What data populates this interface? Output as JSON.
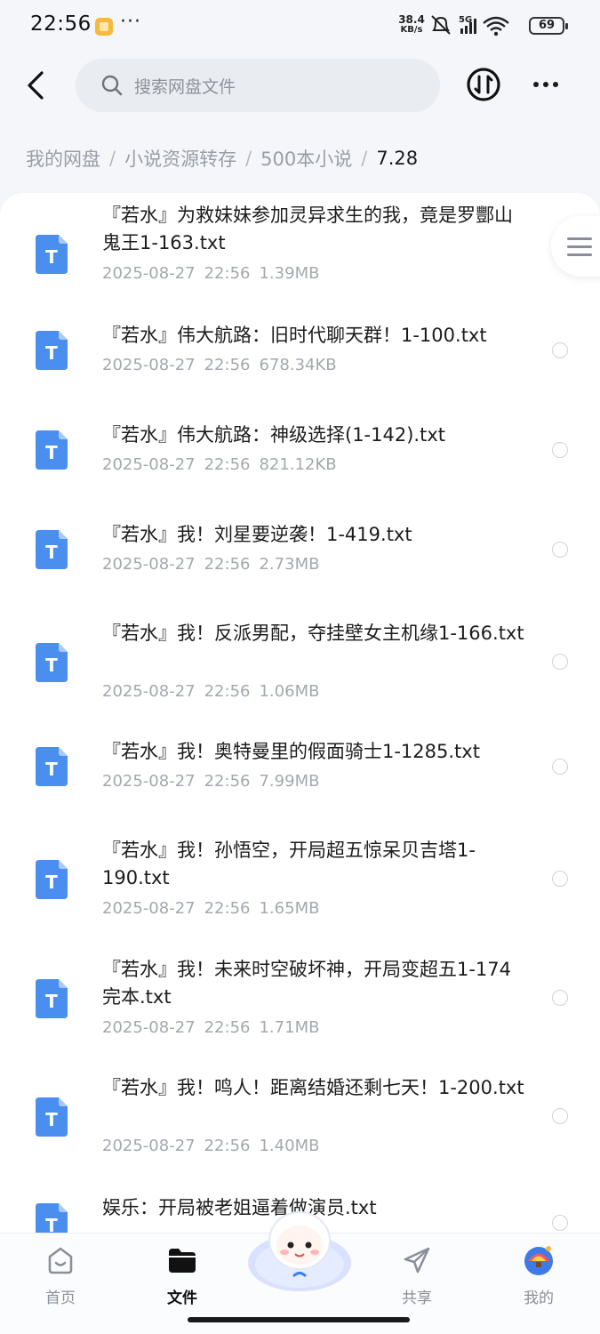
{
  "status_bar": {
    "time": "22:56",
    "more": "···",
    "speed_value": "38.4",
    "speed_unit": "KB/s",
    "network": "5G",
    "battery": "69"
  },
  "header": {
    "search_placeholder": "搜索网盘文件"
  },
  "breadcrumb": {
    "items": [
      "我的网盘",
      "小说资源转存",
      "500本小说"
    ],
    "current": "7.28",
    "separator": "/"
  },
  "files": [
    {
      "name": "『若水』为救妹妹参加灵异求生的我，竟是罗酆山鬼王1-163.txt",
      "date": "2025-08-27",
      "time": "22:56",
      "size": "1.39MB"
    },
    {
      "name": "『若水』伟大航路：旧时代聊天群！1-100.txt",
      "date": "2025-08-27",
      "time": "22:56",
      "size": "678.34KB"
    },
    {
      "name": "『若水』伟大航路：神级选择(1-142).txt",
      "date": "2025-08-27",
      "time": "22:56",
      "size": "821.12KB"
    },
    {
      "name": "『若水』我！刘星要逆袭！1-419.txt",
      "date": "2025-08-27",
      "time": "22:56",
      "size": "2.73MB"
    },
    {
      "name": "『若水』我！反派男配，夺挂壁女主机缘1-166.txt",
      "date": "2025-08-27",
      "time": "22:56",
      "size": "1.06MB"
    },
    {
      "name": "『若水』我！奥特曼里的假面骑士1-1285.txt",
      "date": "2025-08-27",
      "time": "22:56",
      "size": "7.99MB"
    },
    {
      "name": "『若水』我！孙悟空，开局超五惊呆贝吉塔1-190.txt",
      "date": "2025-08-27",
      "time": "22:56",
      "size": "1.65MB"
    },
    {
      "name": "『若水』我！未来时空破坏神，开局变超五1-174完本.txt",
      "date": "2025-08-27",
      "time": "22:56",
      "size": "1.71MB"
    },
    {
      "name": "『若水』我！鸣人！距离结婚还剩七天！1-200.txt",
      "date": "2025-08-27",
      "time": "22:56",
      "size": "1.40MB"
    },
    {
      "name": "娱乐：开局被老姐逼着做演员.txt",
      "date": "",
      "time": "",
      "size": ""
    }
  ],
  "file_icon_letter": "T",
  "nav": {
    "home": "首页",
    "files": "文件",
    "share": "共享",
    "me": "我的"
  },
  "colors": {
    "accent": "#3b82f6",
    "file_icon": "#4a8ef0",
    "background": "#f4f6fa"
  }
}
